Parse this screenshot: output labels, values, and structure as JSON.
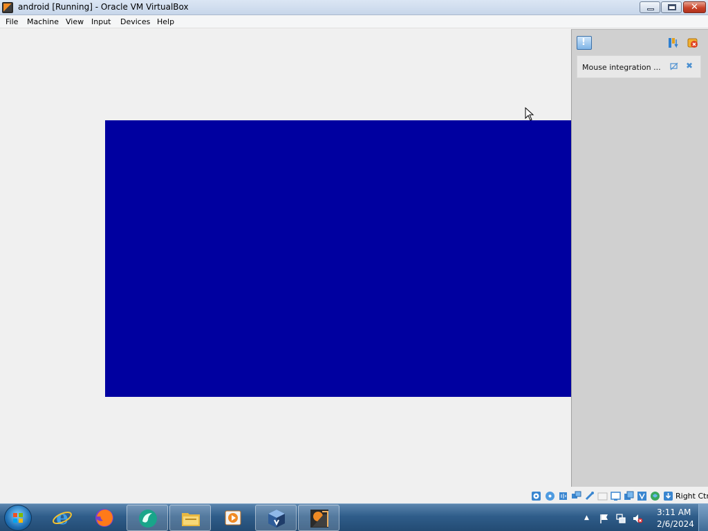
{
  "window": {
    "title": "android  [Running] - Oracle VM VirtualBox",
    "close_glyph": "✕"
  },
  "menu": {
    "items": [
      "File",
      "Machine",
      "View",
      "Input",
      "Devices",
      "Help"
    ]
  },
  "vm": {
    "screen_color": "#0000a0"
  },
  "notifications": {
    "toggle_glyph": "!",
    "items": [
      {
        "text": "Mouse integration ..."
      }
    ],
    "dismiss_glyph": "✖"
  },
  "statusbar": {
    "host_key": "Right Ctrl"
  },
  "taskbar": {
    "clock_time": "3:11 AM",
    "clock_date": "2/6/2024",
    "tray_chevron": "▲"
  }
}
